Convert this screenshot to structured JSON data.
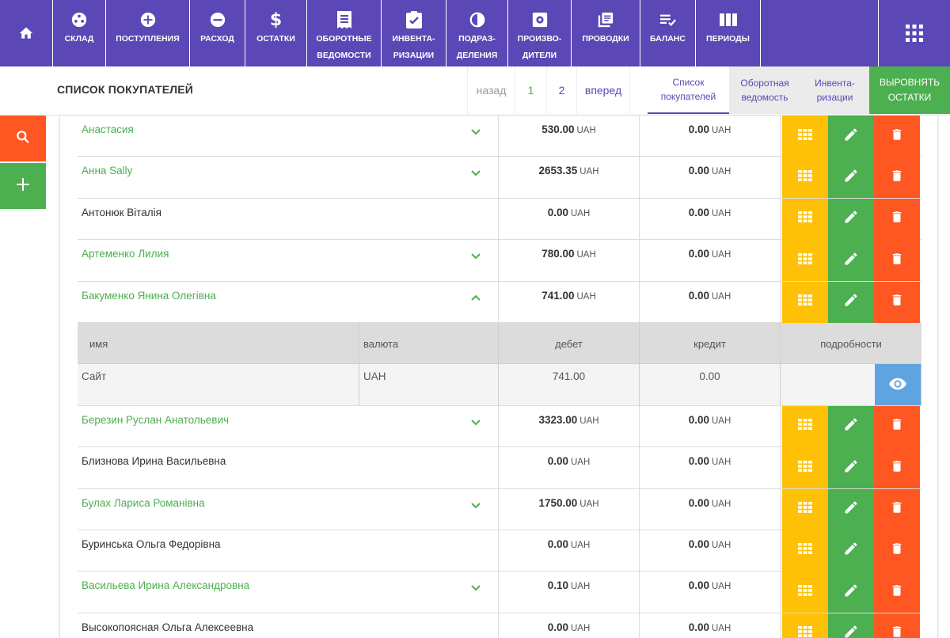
{
  "nav": {
    "home_icon": "home-icon",
    "items": [
      {
        "label": "СКЛАД",
        "icon": "warehouse-icon"
      },
      {
        "label": "ПОСТУПЛЕНИЯ",
        "icon": "plus-circle-icon"
      },
      {
        "label": "РАСХОД",
        "icon": "minus-circle-icon"
      },
      {
        "label": "ОСТАТКИ",
        "icon": "dollar-icon"
      },
      {
        "label": "ОБОРОТНЫЕ\nВЕДОМОСТИ",
        "icon": "receipt-icon"
      },
      {
        "label": "ИНВЕНТА-\nРИЗАЦИИ",
        "icon": "clipboard-check-icon"
      },
      {
        "label": "ПОДРАЗ-\nДЕЛЕНИЯ",
        "icon": "half-circle-icon"
      },
      {
        "label": "ПРОИЗВО-\nДИТЕЛИ",
        "icon": "gear-box-icon"
      },
      {
        "label": "ПРОВОДКИ",
        "icon": "library-icon"
      },
      {
        "label": "БАЛАНС",
        "icon": "list-check-icon"
      },
      {
        "label": "ПЕРИОДЫ",
        "icon": "columns-icon"
      }
    ],
    "apps_icon": "apps-grid-icon"
  },
  "subheader": {
    "title": "СПИСОК ПОКУПАТЕЛЕЙ",
    "pager": {
      "back": "назад",
      "page1": "1",
      "page2": "2",
      "forward": "вперед"
    },
    "tabs": [
      {
        "label": "Список\nпокупателей",
        "active": true
      },
      {
        "label": "Оборотная\nведомость",
        "active": false
      },
      {
        "label": "Инвента-\nризации",
        "active": false
      }
    ],
    "align_button": "ВЫРОВНЯТЬ\nОСТАТКИ"
  },
  "side": {
    "search_icon": "search-icon",
    "add_icon": "plus-icon"
  },
  "colors": {
    "purple": "#5b47b5",
    "green": "#4caf50",
    "orange": "#ff5722",
    "yellow": "#ffc107",
    "blue": "#5fa3e0"
  },
  "currency": "UAH",
  "customers_before": [
    {
      "name": "Анастасия",
      "debit": "530.00",
      "credit": "0.00",
      "expandable": true,
      "expanded": false
    },
    {
      "name": "Анна Sally",
      "debit": "2653.35",
      "credit": "0.00",
      "expandable": true,
      "expanded": false
    },
    {
      "name": "Антонюк Віталія",
      "debit": "0.00",
      "credit": "0.00",
      "expandable": false,
      "expanded": false
    },
    {
      "name": "Артеменко Лилия",
      "debit": "780.00",
      "credit": "0.00",
      "expandable": true,
      "expanded": false
    },
    {
      "name": "Бакуменко Янина Олегівна",
      "debit": "741.00",
      "credit": "0.00",
      "expandable": true,
      "expanded": true
    }
  ],
  "detail": {
    "headers": {
      "name": "имя",
      "currency": "валюта",
      "debit": "дебет",
      "credit": "кредит",
      "details": "подробности"
    },
    "row": {
      "name": "Сайт",
      "currency": "UAH",
      "debit": "741.00",
      "credit": "0.00"
    }
  },
  "customers_after": [
    {
      "name": "Березин Руслан Анатольевич",
      "debit": "3323.00",
      "credit": "0.00",
      "expandable": true,
      "expanded": false
    },
    {
      "name": "Близнова Ирина Васильевна",
      "debit": "0.00",
      "credit": "0.00",
      "expandable": false,
      "expanded": false
    },
    {
      "name": "Булах Лариса Романівна",
      "debit": "1750.00",
      "credit": "0.00",
      "expandable": true,
      "expanded": false
    },
    {
      "name": "Буринська Ольга Федорівна",
      "debit": "0.00",
      "credit": "0.00",
      "expandable": false,
      "expanded": false
    },
    {
      "name": "Васильева Ирина Александровна",
      "debit": "0.10",
      "credit": "0.00",
      "expandable": true,
      "expanded": false
    },
    {
      "name": "Высокопоясная Ольга Алексеевна",
      "debit": "0.00",
      "credit": "0.00",
      "expandable": false,
      "expanded": false
    }
  ]
}
